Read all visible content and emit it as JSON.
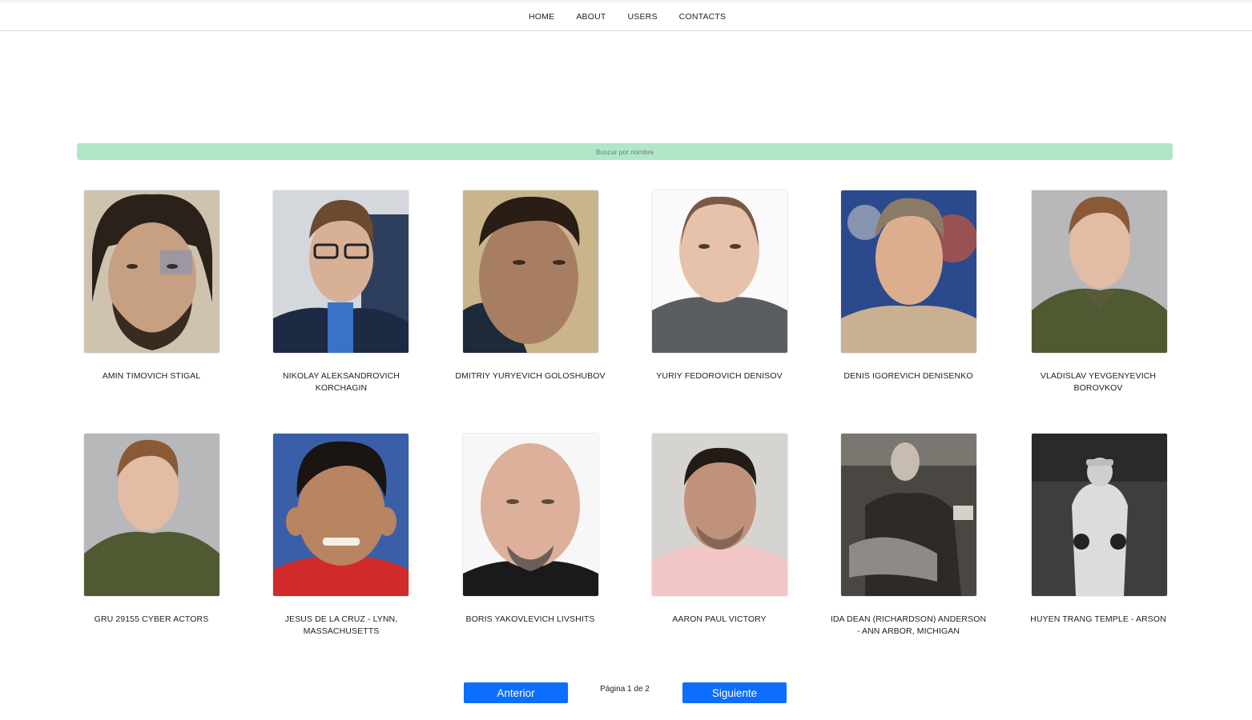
{
  "nav": {
    "items": [
      "HOME",
      "ABOUT",
      "USERS",
      "CONTACTS"
    ]
  },
  "search": {
    "placeholder": "Buscar por nombre"
  },
  "cards": [
    {
      "name": "AMIN TIMOVICH STIGAL"
    },
    {
      "name": "NIKOLAY ALEKSANDROVICH KORCHAGIN"
    },
    {
      "name": "DMITRIY YURYEVICH GOLOSHUBOV"
    },
    {
      "name": "YURIY FEDOROVICH DENISOV"
    },
    {
      "name": "DENIS IGOREVICH DENISENKO"
    },
    {
      "name": "VLADISLAV YEVGENYEVICH BOROVKOV"
    },
    {
      "name": "GRU 29155 CYBER ACTORS"
    },
    {
      "name": "JESUS DE LA CRUZ - LYNN, MASSACHUSETTS"
    },
    {
      "name": "BORIS YAKOVLEVICH LIVSHITS"
    },
    {
      "name": "AARON PAUL VICTORY"
    },
    {
      "name": "IDA DEAN (RICHARDSON) ANDERSON - ANN ARBOR, MICHIGAN"
    },
    {
      "name": "HUYEN TRANG TEMPLE - ARSON"
    }
  ],
  "pagination": {
    "prev_label": "Anterior",
    "page_text": "Página 1 de 2",
    "next_label": "Siguiente"
  },
  "colors": {
    "search_bg": "#b2e6c9",
    "button_bg": "#0d6efd"
  }
}
